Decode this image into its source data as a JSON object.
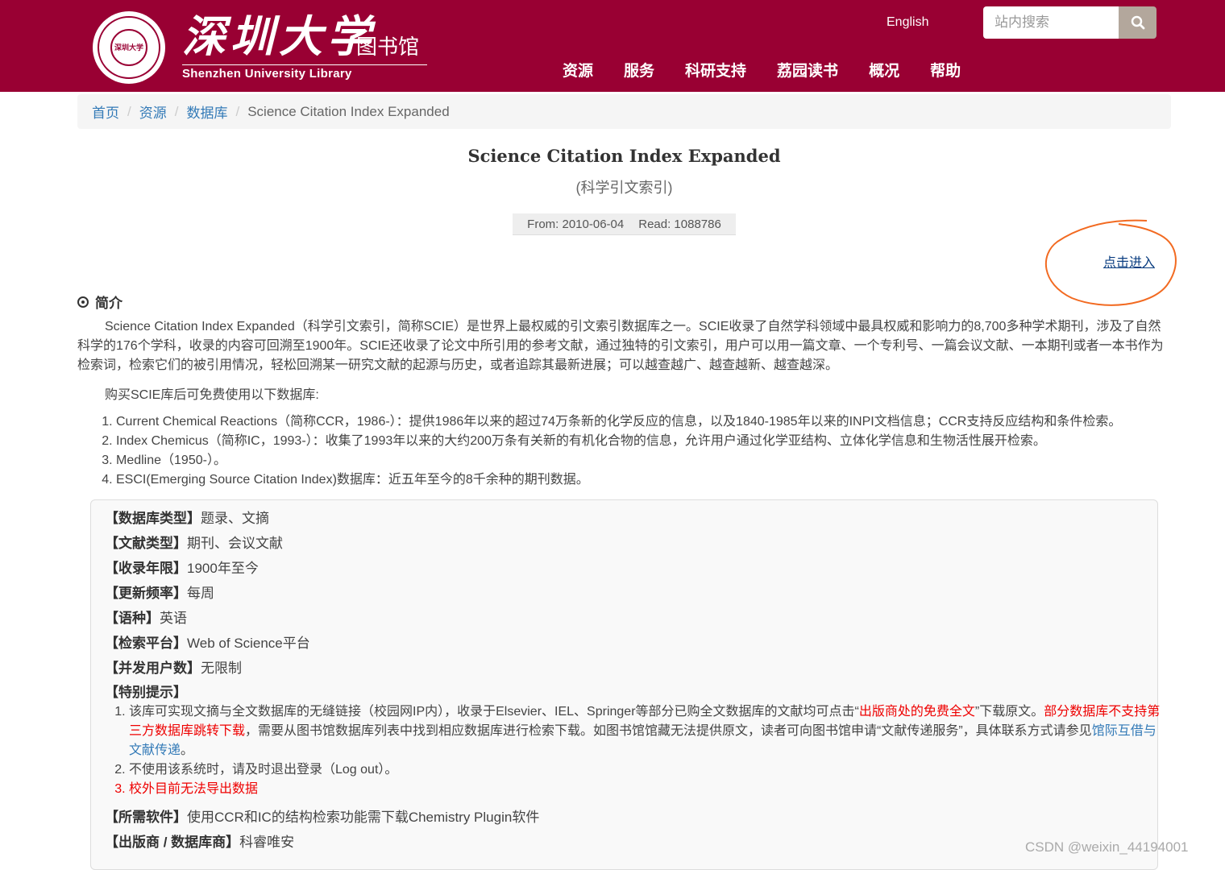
{
  "header": {
    "seal_text": "深圳大学",
    "logo_cn": "深圳大学",
    "logo_lib": "图书馆",
    "logo_en": "Shenzhen University Library",
    "lang_link": "English",
    "search_placeholder": "站内搜索",
    "nav": [
      "资源",
      "服务",
      "科研支持",
      "荔园读书",
      "概况",
      "帮助"
    ],
    "brand_color": "#990033"
  },
  "breadcrumb": {
    "items": [
      "首页",
      "资源",
      "数据库"
    ],
    "current": "Science Citation Index Expanded"
  },
  "db": {
    "title": "Science Citation Index Expanded",
    "subtitle": "(科学引文索引)",
    "from_label": "From: 2010-06-04",
    "read_label": "Read: 1088786",
    "enter_link": "点击进入"
  },
  "intro": {
    "heading": "简介",
    "para1": "Science Citation Index Expanded（科学引文索引，简称SCIE）是世界上最权威的引文索引数据库之一。SCIE收录了自然学科领域中最具权威和影响力的8,700多种学术期刊，涉及了自然科学的176个学科，收录的内容可回溯至1900年。SCIE还收录了论文中所引用的参考文献，通过独特的引文索引，用户可以用一篇文章、一个专利号、一篇会议文献、一本期刊或者一本书作为检索词，检索它们的被引用情况，轻松回溯某一研究文献的起源与历史，或者追踪其最新进展；可以越查越广、越查越新、越查越深。",
    "para2": "购买SCIE库后可免费使用以下数据库:",
    "list": [
      "Current Chemical Reactions（简称CCR，1986-）：提供1986年以来的超过74万条新的化学反应的信息，以及1840-1985年以来的INPI文档信息；CCR支持反应结构和条件检索。",
      "Index Chemicus（简称IC，1993-）：收集了1993年以来的大约200万条有关新的有机化合物的信息，允许用户通过化学亚结构、立体化学信息和生物活性展开检索。",
      "Medline（1950-）。",
      "ESCI(Emerging Source Citation Index)数据库：近五年至今的8千余种的期刊数据。"
    ]
  },
  "info": {
    "db_type_label": "【数据库类型】",
    "db_type": "题录、文摘",
    "doc_type_label": "【文献类型】",
    "doc_type": "期刊、会议文献",
    "years_label": "【收录年限】",
    "years": "1900年至今",
    "freq_label": "【更新频率】",
    "freq": "每周",
    "lang_label": "【语种】",
    "lang": "英语",
    "platform_label": "【检索平台】",
    "platform": "Web of Science平台",
    "users_label": "【并发用户数】",
    "users": "无限制",
    "tips_label": "【特别提示】",
    "tip1_a": "该库可实现文摘与全文数据库的无缝链接（校园网IP内），收录于Elsevier、IEL、Springer等部分已购全文数据库的文献均可点击“",
    "tip1_red1": "出版商处的免费全文",
    "tip1_b": "”下载原文。",
    "tip1_red2": "部分数据库不支持第三方数据库跳转下载",
    "tip1_c": "，需要从图书馆数据库列表中找到相应数据库进行检索下载。如图书馆馆藏无法提供原文，读者可向图书馆申请“文献传递服务”，具体联系方式请参见",
    "tip1_link": "馆际互借与文献传递",
    "tip1_d": "。",
    "tip2": "不使用该系统时，请及时退出登录（Log out）。",
    "tip3": "校外目前无法导出数据",
    "software_label": "【所需软件】",
    "software": "使用CCR和IC的结构检索功能需下载Chemistry Plugin软件",
    "publisher_label": "【出版商 / 数据库商】",
    "publisher": "科睿唯安"
  },
  "watermark": "CSDN @weixin_44194001"
}
